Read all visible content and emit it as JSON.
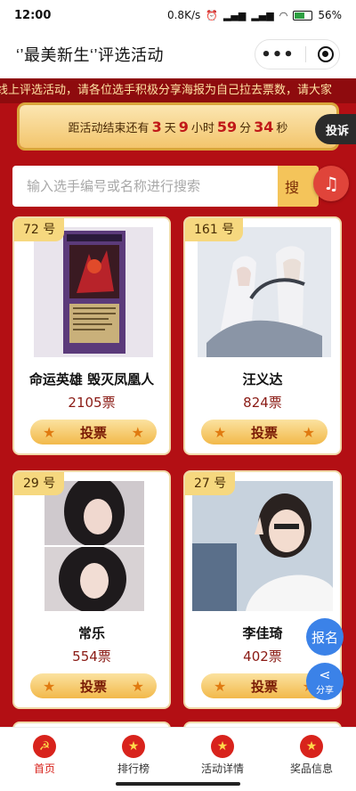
{
  "status_bar": {
    "time": "12:00",
    "network_speed": "0.8K/s",
    "battery_percent": "56%",
    "battery_level": 0.56
  },
  "title_bar": {
    "title": "‘’最美新生‘’评选活动"
  },
  "marquee": {
    "text": "线上评选活动，请各位选手积极分享海报为自己拉去票数，请大家"
  },
  "countdown": {
    "prefix": "距活动结束还有",
    "days": "3",
    "days_unit": "天",
    "hours": "9",
    "hours_unit": "小时",
    "minutes": "59",
    "minutes_unit": "分",
    "seconds": "34",
    "seconds_unit": "秒"
  },
  "complaint_label": "投诉",
  "search": {
    "placeholder": "输入选手编号或名称进行搜索",
    "button_label": "搜"
  },
  "contestants": [
    {
      "number": "72 号",
      "name": "命运英雄 毁灭凤凰人",
      "votes": "2105票",
      "vote_label": "投票"
    },
    {
      "number": "161 号",
      "name": "汪义达",
      "votes": "824票",
      "vote_label": "投票"
    },
    {
      "number": "29 号",
      "name": "常乐",
      "votes": "554票",
      "vote_label": "投票"
    },
    {
      "number": "27 号",
      "name": "李佳琦",
      "votes": "402票",
      "vote_label": "投票"
    }
  ],
  "floating": {
    "signup_label": "报名",
    "share_label": "分享"
  },
  "bottom_nav": [
    {
      "label": "首页",
      "icon": "hammer-sickle-icon",
      "active": true
    },
    {
      "label": "排行榜",
      "icon": "star-icon",
      "active": false
    },
    {
      "label": "活动详情",
      "icon": "flag-icon",
      "active": false
    },
    {
      "label": "奖品信息",
      "icon": "flag-icon",
      "active": false
    }
  ],
  "colors": {
    "background_red": "#b30f14",
    "gold": "#f4c45a",
    "accent_blue": "#3b82e8",
    "vote_red": "#8a1a14"
  }
}
